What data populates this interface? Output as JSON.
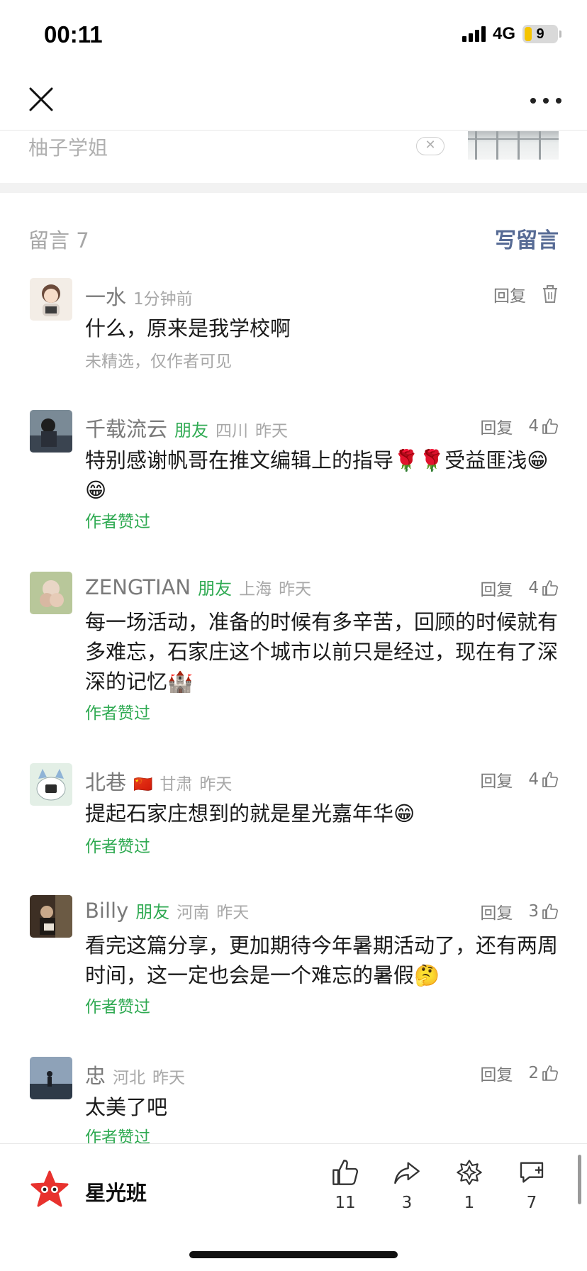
{
  "status_bar": {
    "time": "00:11",
    "network": "4G",
    "battery": "9"
  },
  "prev_article": {
    "author": "柚子学姐"
  },
  "comments_header": {
    "count_label": "留言 7",
    "write_label": "写留言"
  },
  "comments": [
    {
      "name": "一水",
      "time": "1分钟前",
      "reply": "回复",
      "text": "什么，原来是我学校啊",
      "note": "未精选，仅作者可见"
    },
    {
      "name": "千载流云",
      "friend": "朋友",
      "location": "四川",
      "time": "昨天",
      "reply": "回复",
      "likes": "4",
      "text": "特别感谢帆哥在推文编辑上的指导🌹🌹受益匪浅😁😁",
      "tag": "作者赞过"
    },
    {
      "name": "ZENGTIAN",
      "friend": "朋友",
      "location": "上海",
      "time": "昨天",
      "reply": "回复",
      "likes": "4",
      "text": "每一场活动，准备的时候有多辛苦，回顾的时候就有多难忘，石家庄这个城市以前只是经过，现在有了深深的记忆🏰",
      "tag": "作者赞过"
    },
    {
      "name": "北巷",
      "flag": "🇨🇳",
      "location": "甘肃",
      "time": "昨天",
      "reply": "回复",
      "likes": "4",
      "text": "提起石家庄想到的就是星光嘉年华😁",
      "tag": "作者赞过"
    },
    {
      "name": "Billy",
      "friend": "朋友",
      "location": "河南",
      "time": "昨天",
      "reply": "回复",
      "likes": "3",
      "text": "看完这篇分享，更加期待今年暑期活动了，还有两周时间，这一定也会是一个难忘的暑假🤔",
      "tag": "作者赞过"
    },
    {
      "name": "忠",
      "location": "河北",
      "time": "昨天",
      "reply": "回复",
      "likes": "2",
      "text": "太美了吧",
      "tag": "作者赞过"
    }
  ],
  "bottom_bar": {
    "account_name": "星光班",
    "like_count": "11",
    "share_count": "3",
    "wow_count": "1",
    "comment_count": "7"
  },
  "colors": {
    "accent_link": "#576b95",
    "friend_green": "#2faa52",
    "battery_yellow": "#f5c400"
  }
}
